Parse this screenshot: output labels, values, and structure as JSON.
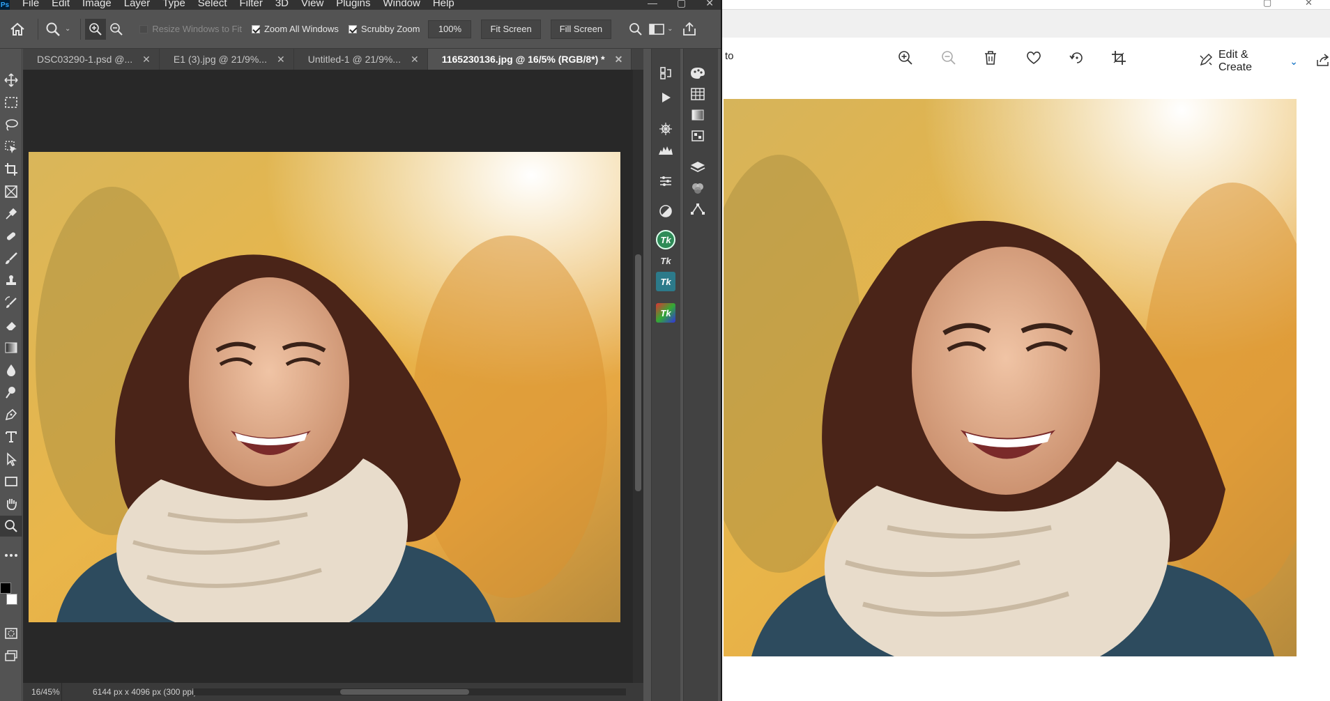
{
  "photoshop": {
    "menu": [
      "File",
      "Edit",
      "Image",
      "Layer",
      "Type",
      "Select",
      "Filter",
      "3D",
      "View",
      "Plugins",
      "Window",
      "Help"
    ],
    "options": {
      "resize_windows": "Resize Windows to Fit",
      "zoom_all_windows": "Zoom All Windows",
      "scrubby_zoom": "Scrubby Zoom",
      "zoom_value": "100%",
      "fit_screen": "Fit Screen",
      "fill_screen": "Fill Screen"
    },
    "tabs": [
      {
        "label": "DSC03290-1.psd @..."
      },
      {
        "label": "E1 (3).jpg @ 21/9%..."
      },
      {
        "label": "Untitled-1 @ 21/9%..."
      },
      {
        "label": "1165230136.jpg @ 16/5% (RGB/8*) *"
      }
    ],
    "status": {
      "zoom": "16/45%",
      "doc_info": "6144 px x 4096 px (300 ppi)"
    },
    "panel_badges": [
      "Tk",
      "Tk",
      "Tk",
      "Tk"
    ]
  },
  "photos_app": {
    "partial_label": "to",
    "edit_create": "Edit & Create"
  },
  "colors": {
    "ps_bg": "#535353",
    "ps_canvas": "#282828",
    "tk_green": "#2e8b57",
    "accent_blue": "#0067c0"
  }
}
